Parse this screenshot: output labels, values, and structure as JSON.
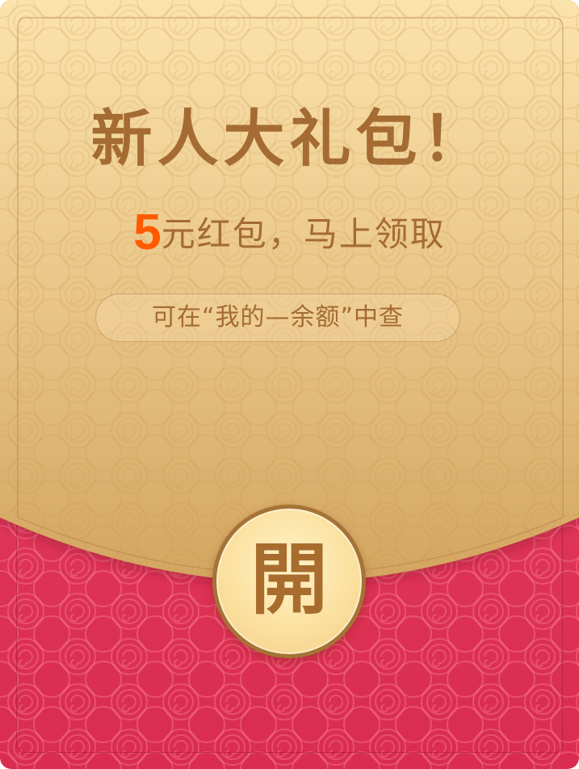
{
  "packet": {
    "title": "新人大礼包！",
    "amount": "5",
    "subtitle_text": "元红包，马上领取",
    "hint": "可在“我的—余额”中查",
    "open_label": "開"
  },
  "colors": {
    "gold_top": "#fbe3ad",
    "gold_bottom": "#d5a863",
    "red": "#e23a5c",
    "text_brown": "#a46b33",
    "amount_orange": "#ff5a00"
  },
  "icons": {
    "background_pattern": "auspicious-cloud-swirl-pattern"
  }
}
